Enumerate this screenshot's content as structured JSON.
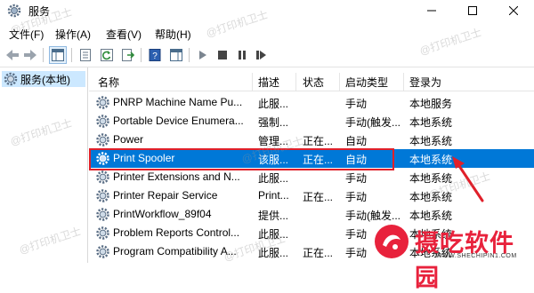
{
  "window": {
    "title": "服务"
  },
  "menu": [
    "文件(F)",
    "操作(A)",
    "查看(V)",
    "帮助(H)"
  ],
  "tree": {
    "root_label": "服务(本地)"
  },
  "columns": {
    "name": "名称",
    "desc": "描述",
    "status": "状态",
    "startup": "启动类型",
    "logon": "登录为"
  },
  "services": [
    {
      "name": "PNRP Machine Name Pu...",
      "desc": "此服...",
      "status": "",
      "startup": "手动",
      "logon": "本地服务"
    },
    {
      "name": "Portable Device Enumera...",
      "desc": "强制...",
      "status": "",
      "startup": "手动(触发...",
      "logon": "本地系统"
    },
    {
      "name": "Power",
      "desc": "管理...",
      "status": "正在...",
      "startup": "自动",
      "logon": "本地系统"
    },
    {
      "name": "Print Spooler",
      "desc": "该服...",
      "status": "正在...",
      "startup": "自动",
      "logon": "本地系统",
      "selected": true
    },
    {
      "name": "Printer Extensions and N...",
      "desc": "此服...",
      "status": "",
      "startup": "手动",
      "logon": "本地系统"
    },
    {
      "name": "Printer Repair Service",
      "desc": "Print...",
      "status": "正在...",
      "startup": "手动",
      "logon": "本地系统"
    },
    {
      "name": "PrintWorkflow_89f04",
      "desc": "提供...",
      "status": "",
      "startup": "手动(触发...",
      "logon": "本地系统"
    },
    {
      "name": "Problem Reports Control...",
      "desc": "此服...",
      "status": "",
      "startup": "手动",
      "logon": "本地系统"
    },
    {
      "name": "Program Compatibility A...",
      "desc": "此服...",
      "status": "正在...",
      "startup": "手动",
      "logon": "本地系统"
    }
  ],
  "watermark": "@打印机卫士",
  "brand": {
    "name": "摄吃软件园",
    "url": "WWW.SHECHIPIN1.COM"
  },
  "colors": {
    "selection": "#0078d7",
    "highlight_box": "#e0202a",
    "brand": "#e8223c"
  }
}
